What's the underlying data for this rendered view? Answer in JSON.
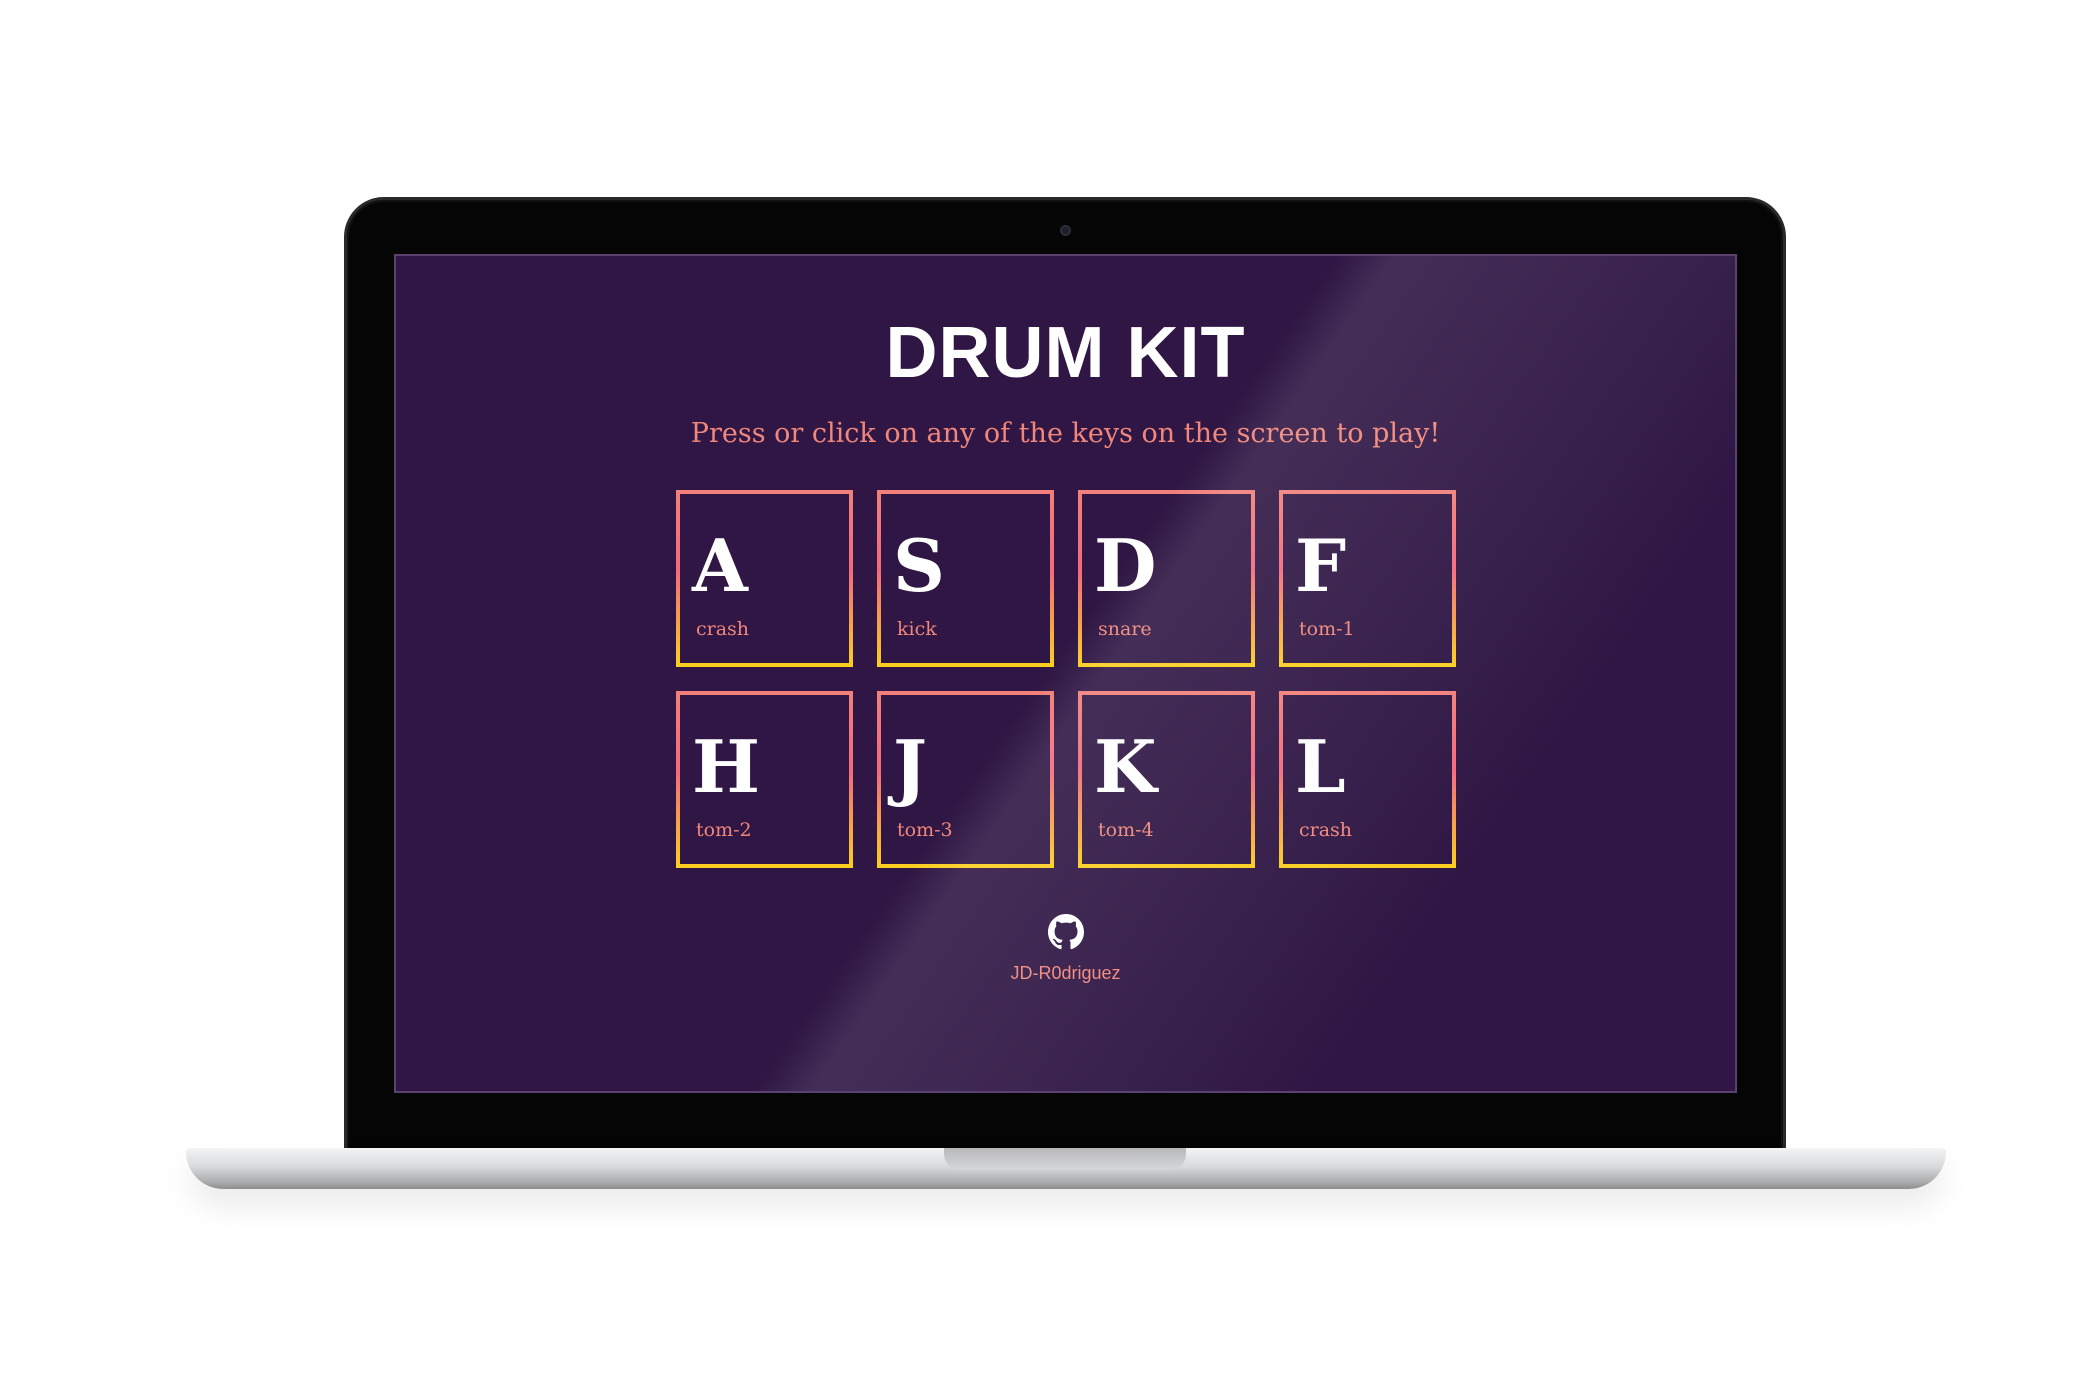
{
  "app": {
    "title": "DRUM KIT",
    "subtitle": "Press or click on any of the keys on the screen to play!"
  },
  "keys": [
    {
      "letter": "A",
      "sound": "crash"
    },
    {
      "letter": "S",
      "sound": "kick"
    },
    {
      "letter": "D",
      "sound": "snare"
    },
    {
      "letter": "F",
      "sound": "tom-1"
    },
    {
      "letter": "H",
      "sound": "tom-2"
    },
    {
      "letter": "J",
      "sound": "tom-3"
    },
    {
      "letter": "K",
      "sound": "tom-4"
    },
    {
      "letter": "L",
      "sound": "crash"
    }
  ],
  "footer": {
    "github_icon": "github-icon",
    "github_user": "JD-R0driguez"
  },
  "colors": {
    "background": "#2f1644",
    "accent": "#f1867a",
    "border_top": "#f2807a",
    "border_bottom": "#fbd01e",
    "text": "#ffffff"
  }
}
